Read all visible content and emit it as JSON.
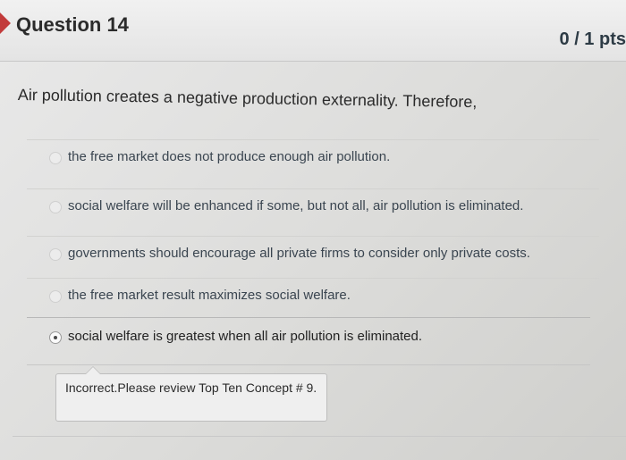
{
  "question": {
    "title": "Question 14",
    "points": "0 / 1 pts",
    "prompt": "Air pollution creates a negative production externality. Therefore,",
    "answers": [
      {
        "label": "the free market does not produce enough air pollution.",
        "selected": false
      },
      {
        "label": "social welfare will be enhanced if some, but not all, air pollution is eliminated.",
        "selected": false
      },
      {
        "label": "governments should encourage all private firms to consider only private costs.",
        "selected": false
      },
      {
        "label": "the free market result maximizes social welfare.",
        "selected": false
      },
      {
        "label": "social welfare is greatest when all air pollution is eliminated.",
        "selected": true
      }
    ],
    "feedback": "Incorrect.Please review Top Ten Concept # 9."
  },
  "colors": {
    "header_marker": "#c23b3b",
    "text": "#2d3b45"
  }
}
